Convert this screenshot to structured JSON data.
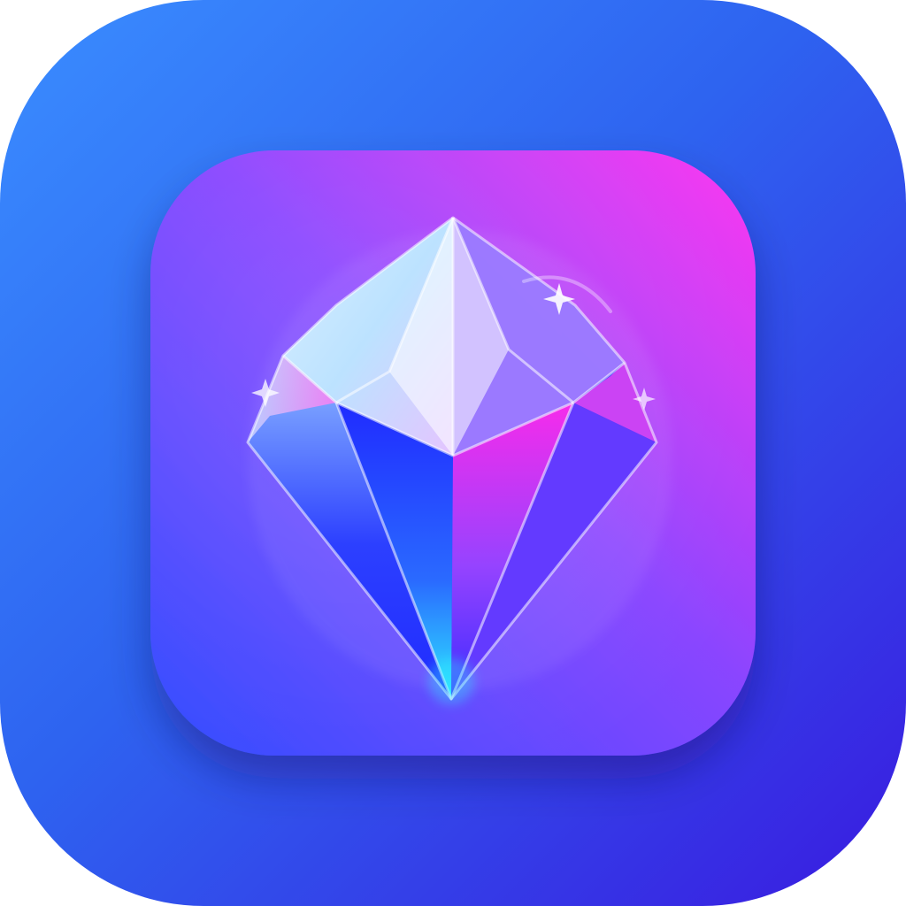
{
  "icon": {
    "name": "diamond-gem-app-icon",
    "outer_gradient": {
      "top_left": "#3A8DFF",
      "mid": "#2E63F0",
      "bottom_right": "#3A1BE0"
    },
    "inner_gradient": {
      "top_right": "#FF35F0",
      "mid": "#8A45FF",
      "bottom_left": "#2F4CFF"
    },
    "gem_colors": {
      "highlight": "#FFFFFF",
      "ice": "#BFE6FF",
      "cyan": "#2EF2FF",
      "blue": "#1F2BFF",
      "magenta": "#FF2BEA",
      "violet": "#9A44FF"
    }
  }
}
